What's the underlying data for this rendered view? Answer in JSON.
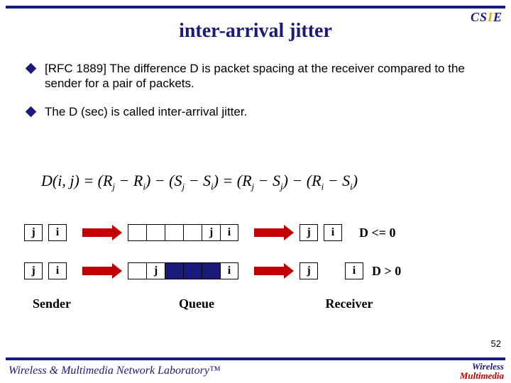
{
  "logo": {
    "c": "C",
    "s": "S",
    "mid": "I",
    "e": "E"
  },
  "title": "inter-arrival jitter",
  "bullets": [
    "[RFC 1889] The difference D is packet spacing at the receiver compared to the sender for a pair of packets.",
    "The D (sec) is called inter-arrival jitter."
  ],
  "formula": {
    "lhs": "D(i, j)",
    "rhs1a": "R",
    "rhs1a_sub": "j",
    "rhs1b": "R",
    "rhs1b_sub": "i",
    "rhs1c": "S",
    "rhs1c_sub": "j",
    "rhs1d": "S",
    "rhs1d_sub": "i",
    "rhs2a": "R",
    "rhs2a_sub": "j",
    "rhs2b": "S",
    "rhs2b_sub": "j",
    "rhs2c": "R",
    "rhs2c_sub": "i",
    "rhs2d": "S",
    "rhs2d_sub": "i"
  },
  "packets": {
    "j": "j",
    "i": "i"
  },
  "dlabels": {
    "le": "D <= 0",
    "gt": "D > 0"
  },
  "columns": {
    "sender": "Sender",
    "queue": "Queue",
    "receiver": "Receiver"
  },
  "pagenum": "52",
  "footer": "Wireless & Multimedia Network Laboratory™",
  "footer_logo": {
    "line1": "Wireless",
    "line2": "Multimedia"
  }
}
